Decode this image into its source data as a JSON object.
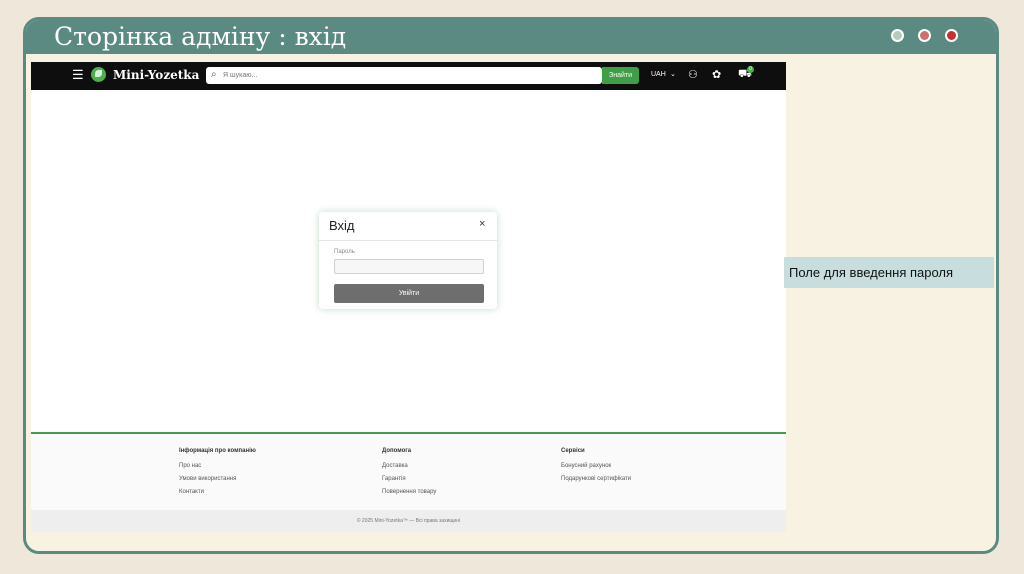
{
  "slide": {
    "title": "Сторінка адміну : вхід",
    "callout": "Поле для введення пароля"
  },
  "app": {
    "logo": "Mini-Yozetka",
    "search": {
      "placeholder": "Я шукаю...",
      "button": "Знайти"
    },
    "currency": "UAH",
    "cart_count": "0",
    "icons": [
      "menu-icon",
      "logo-icon",
      "search-icon",
      "chevron-down-icon",
      "user-icon",
      "gift-icon",
      "cart-icon"
    ]
  },
  "modal": {
    "title": "Вхід",
    "close": "×",
    "password_label": "Пароль",
    "password_value": "",
    "submit": "Увійти"
  },
  "footer": {
    "columns": [
      {
        "heading": "Інформація про компанію",
        "links": [
          "Про нас",
          "Умови використання",
          "Контакти"
        ]
      },
      {
        "heading": "Допомога",
        "links": [
          "Доставка",
          "Гарантія",
          "Повернення товару"
        ]
      },
      {
        "heading": "Сервіси",
        "links": [
          "Бонусний рахунок",
          "Подарункові сертифікати"
        ]
      }
    ],
    "copyright": "© 2025 Mini-Yozetka™ — Всі права захищені"
  },
  "colors": {
    "frame": "#5a8a82",
    "brand_green": "#3e9f48",
    "callout_bg": "#c8dede"
  }
}
